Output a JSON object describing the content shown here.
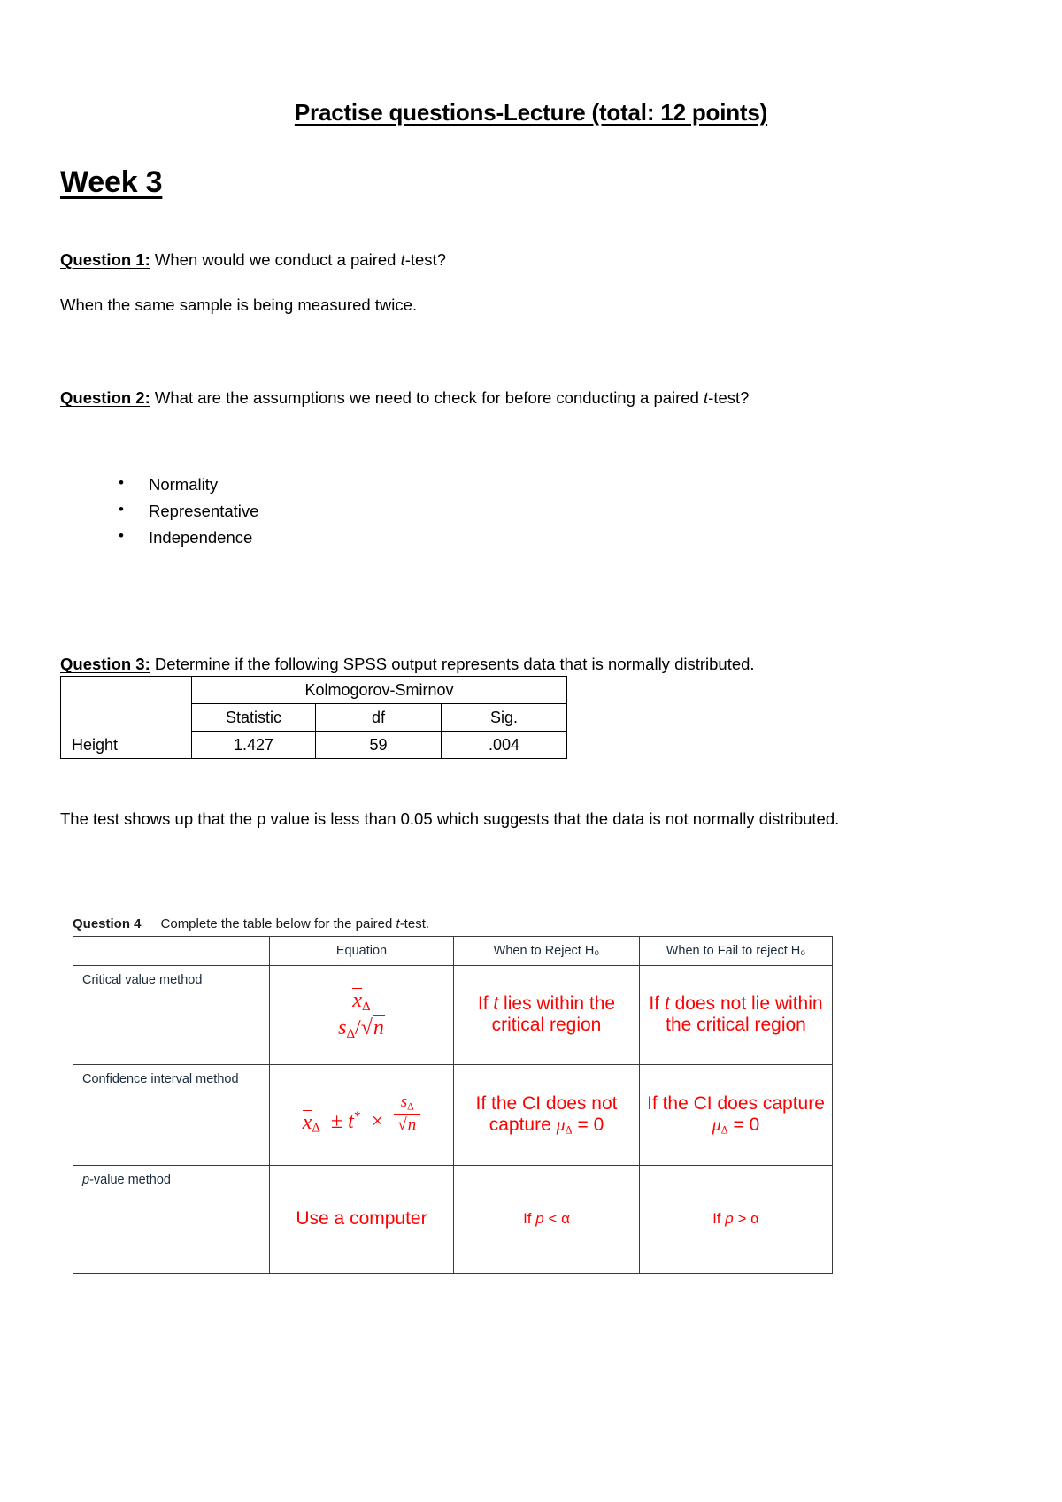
{
  "document": {
    "title": "Practise questions-Lecture (total: 12 points)",
    "week_heading": "Week 3"
  },
  "question1": {
    "label": "Question 1:",
    "prompt_before_italic": " When would we conduct a paired ",
    "italic_token": "t",
    "prompt_after_italic": "-test?",
    "answer": "When the same sample is being measured twice."
  },
  "question2": {
    "label": "Question 2:",
    "prompt_before_italic": " What are the assumptions we need to check for before conducting a paired ",
    "italic_token": "t",
    "prompt_after_italic": "-test?",
    "answers": [
      "Normality",
      "Representative",
      "Independence"
    ]
  },
  "question3": {
    "label": "Question 3:",
    "prompt": " Determine if the following SPSS output represents data that is normally distributed.",
    "table": {
      "group_header": "Kolmogorov-Smirnov",
      "column_headers": [
        "",
        "Statistic",
        "df",
        "Sig."
      ],
      "rows": [
        {
          "label": "Height",
          "statistic": "1.427",
          "df": "59",
          "sig": ".004"
        }
      ]
    },
    "conclusion": "The test shows up that the p value is less than 0.05 which suggests that the data is not normally distributed."
  },
  "question4": {
    "label": "Question 4",
    "prompt_before_italic": "Complete the table below for the paired ",
    "italic_token": "t",
    "prompt_after_italic": "-test.",
    "column_headers": [
      "",
      "Equation",
      "When to Reject H₀",
      "When to Fail to reject H₀"
    ],
    "rows": [
      {
        "method": "Critical value method",
        "equation_alt": "x̄Δ / (sΔ/√n)",
        "reject": "If t lies within the critical region",
        "fail_reject": "If t does not lie within the critical region"
      },
      {
        "method": "Confidence interval method",
        "equation_alt": "x̄Δ ± t* × sΔ/√n",
        "reject": "If the CI does not capture μΔ = 0",
        "fail_reject": "If the CI does capture μΔ = 0"
      },
      {
        "method": "p-value method",
        "equation_alt": "Use a computer",
        "reject": "If p < α",
        "fail_reject": "If p > α"
      }
    ]
  },
  "colors": {
    "answer_red": "#ff0000",
    "header_ink": "#1a2b3c",
    "rule": "#3a3a3a"
  }
}
